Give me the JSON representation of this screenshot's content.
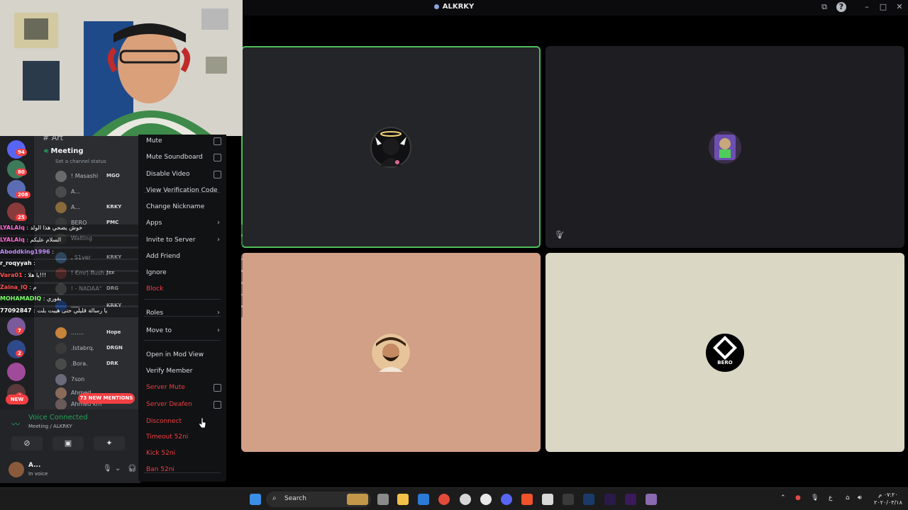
{
  "window": {
    "title": "ALKRKY"
  },
  "channels": {
    "art_label": "Art",
    "voice_channel": "Meeting",
    "channel_status_placeholder": "Set a channel status",
    "members": [
      {
        "name": "! Masashi",
        "tag": "MGO"
      },
      {
        "name": "A...",
        "tag": ""
      },
      {
        "name": "A...",
        "tag": "KRKY"
      },
      {
        "name": "BERO",
        "tag": "PMC"
      },
      {
        "name": "Waiting",
        "tag": ""
      },
      {
        "name": "ـ S1ver",
        "tag": "KRKY"
      },
      {
        "name": "! €mr) Rush",
        "tag": "Jsx"
      },
      {
        "name": "! - NADAA\"",
        "tag": "DRG"
      },
      {
        "name": "ـــــ",
        "tag": "KRKY"
      },
      {
        "name": ".......",
        "tag": "Hope"
      },
      {
        "name": ".Istabrq.",
        "tag": "DRGN"
      },
      {
        "name": ".Bora.",
        "tag": "DRK"
      },
      {
        "name": "7son",
        "tag": ""
      },
      {
        "name": "Ahmed",
        "tag": ""
      },
      {
        "name": "Ahmed km",
        "tag": ""
      }
    ],
    "server_badges": [
      "94",
      "80",
      "208",
      "25",
      "7",
      "2",
      "4"
    ],
    "new_pill": "NEW",
    "mentions_pill": "73 NEW MENTIONS"
  },
  "chat": [
    {
      "user": "LYALAlq",
      "message": "خوش يصحي هذا الولد",
      "color": "#ff6ad5"
    },
    {
      "user": "LYALAlq",
      "message": "السلام عليكم",
      "color": "#ff6ad5"
    },
    {
      "user": "Aboddking1996",
      "message": "",
      "color": "#c38cff"
    },
    {
      "user": "r_roqyyah",
      "message": "",
      "color": "#ffffff"
    },
    {
      "user": "Vara01",
      "message": "يا هلا!!!",
      "color": "#ff4d4d"
    },
    {
      "user": "Zaina_IQ",
      "message": "م",
      "color": "#ff4d4d"
    },
    {
      "user": "MOHAMADIQ",
      "message": "بقوري",
      "color": "#7dff6a"
    },
    {
      "user": "77092847",
      "message": "يا رسالة قليلي حتى هيبت بلت",
      "color": "#ffffff"
    }
  ],
  "voice": {
    "connected_label": "Voice Connected",
    "location": "Meeting / ALKRKY"
  },
  "user": {
    "name": "A...",
    "status": "In voice"
  },
  "context_menu": [
    {
      "label": "Mute",
      "kind": "checkbox"
    },
    {
      "label": "Mute Soundboard",
      "kind": "checkbox"
    },
    {
      "label": "Disable Video",
      "kind": "checkbox"
    },
    {
      "label": "View Verification Code",
      "kind": "plain"
    },
    {
      "label": "Change Nickname",
      "kind": "plain"
    },
    {
      "label": "Apps",
      "kind": "submenu"
    },
    {
      "label": "Invite to Server",
      "kind": "submenu"
    },
    {
      "label": "Add Friend",
      "kind": "plain"
    },
    {
      "label": "Ignore",
      "kind": "plain"
    },
    {
      "label": "Block",
      "kind": "danger"
    },
    {
      "label": "Roles",
      "kind": "submenu"
    },
    {
      "label": "Move to",
      "kind": "submenu"
    },
    {
      "label": "Open in Mod View",
      "kind": "plain"
    },
    {
      "label": "Verify Member",
      "kind": "plain"
    },
    {
      "label": "Server Mute",
      "kind": "danger-checkbox"
    },
    {
      "label": "Server Deafen",
      "kind": "danger-checkbox"
    },
    {
      "label": "Disconnect",
      "kind": "danger"
    },
    {
      "label": "Timeout 52ni",
      "kind": "danger"
    },
    {
      "label": "Kick 52ni",
      "kind": "danger"
    },
    {
      "label": "Ban 52ni",
      "kind": "danger"
    }
  ],
  "tiles": [
    {
      "name": "angel-avatar",
      "bg": "#242528",
      "active": true
    },
    {
      "name": "gamer-avatar",
      "bg": "#1e1d22",
      "active": false
    },
    {
      "name": "bearded-avatar",
      "bg": "#d1a086",
      "active": false
    },
    {
      "name": "bero-avatar",
      "bg": "#dad8c5",
      "active": false,
      "label": "BERO"
    }
  ],
  "taskbar": {
    "search_label": "Search",
    "clock_time": "٠٧:٢٠ م",
    "clock_date": "٢٠٢٠/٠٣/١٨"
  },
  "colors": {
    "accent_green": "#4fbd5a",
    "danger_red": "#f23f43",
    "menu_bg": "#111214"
  }
}
